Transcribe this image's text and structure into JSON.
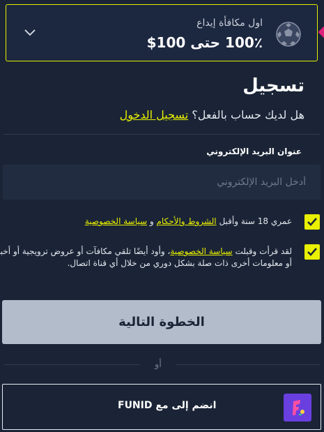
{
  "bonus": {
    "title": "اول مكافأة إيداع",
    "amount": "100٪ حتى 100$",
    "icons": [
      "chevron-down-icon",
      "soccer-ball-icon"
    ],
    "accent_color": "#e9f000"
  },
  "page": {
    "title": "تسجيل",
    "have_account": "هل لديك حساب بالفعل؟",
    "login_link": "تسجيل الدخول"
  },
  "email": {
    "label": "عنوان البريد الإلكتروني",
    "placeholder": "أدخل البريد الإلكتروني",
    "value": ""
  },
  "consent": {
    "age_text_pre": "عمري 18 سنة وأقبل",
    "terms_link": "الشروط والأحكام",
    "and": "و",
    "privacy_link": "سياسة الخصوصية",
    "marketing_pre": "لقد قرأت وقبلت",
    "marketing_privacy_link": "سياسة الخصوصية",
    "marketing_post": "، وأود أيضًا تلقي مكافآت أو عروض ترويجية أو أخبار أو معلومات أخرى ذات صلة بشكل دوري من خلال أي قناة اتصال."
  },
  "actions": {
    "next_label": "الخطوة التالية",
    "or_label": "أو",
    "funid_label": "انضم إلى مع FUNID"
  }
}
